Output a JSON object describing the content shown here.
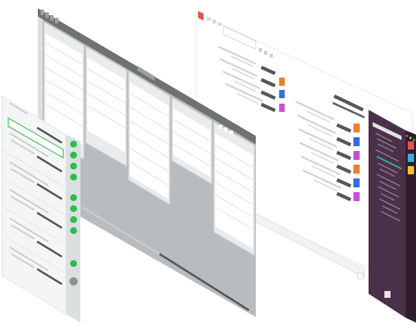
{
  "illustration": {
    "colors": {
      "board_frame": "#6f7173",
      "board_canvas": "#b8bcbe",
      "column_bg": "#e9ebec",
      "card_bg": "#ffffff",
      "sidebar_bg": "#f4f5f5",
      "status_dot": "#2dbd4e",
      "status_dot_inactive": "#8e9092",
      "chat_bg": "#4a3048",
      "chat_highlight": "#3aa39a",
      "accent_red": "#e05456",
      "accent_orange": "#f07b2a",
      "accent_blue": "#2f6fe0",
      "accent_purple": "#c64fd8",
      "accent_yellow": "#f2c230",
      "accent_teal": "#33b3d8"
    },
    "board": {
      "column_count": 5
    },
    "sidebar": {
      "status_dots": [
        "green",
        "green",
        "green",
        "green",
        "green",
        "green",
        "green",
        "green",
        "green",
        "gray"
      ]
    },
    "list_panel": {
      "tag_colors_top": [
        "orange",
        "blue",
        "purple"
      ],
      "tag_colors_bottom": [
        "orange",
        "blue",
        "purple",
        "orange",
        "blue",
        "purple"
      ]
    },
    "chat_panel": {
      "swatches": [
        "red",
        "teal",
        "yellow"
      ]
    }
  }
}
